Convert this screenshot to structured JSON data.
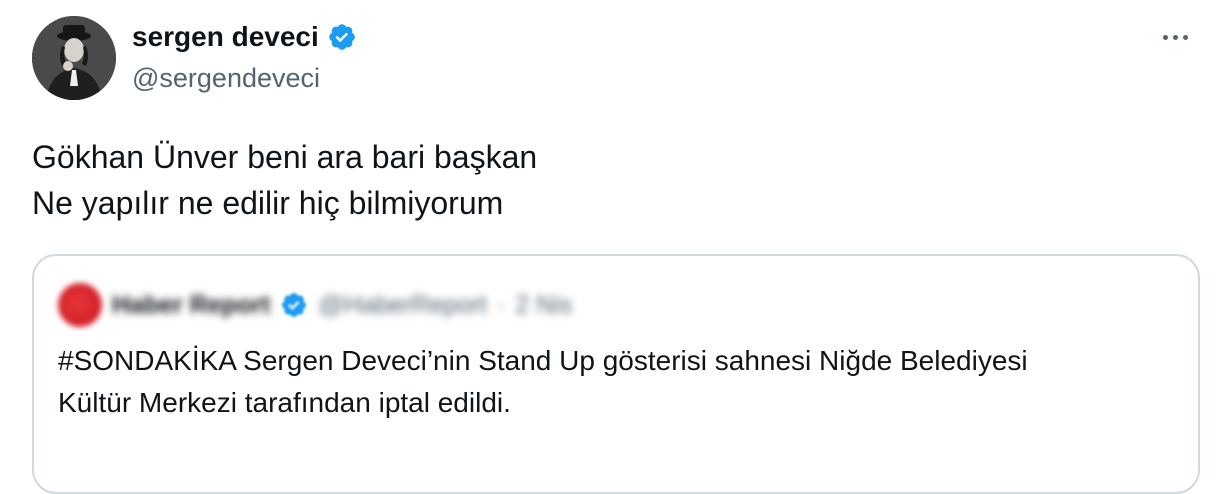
{
  "author": {
    "display_name": "sergen deveci",
    "handle": "@sergendeveci",
    "verified": true
  },
  "tweet": {
    "lines": [
      "Gökhan Ünver beni ara bari başkan",
      "Ne yapılır ne edilir hiç bilmiyorum"
    ]
  },
  "quoted_tweet": {
    "display_name": "Haber Report",
    "handle": "@HaberReport",
    "separator": "·",
    "date": "2 Nis",
    "verified": true,
    "lines": [
      "#SONDAKİKA Sergen Deveci’nin Stand Up gösterisi sahnesi Niğde Belediyesi",
      "Kültür Merkezi tarafından iptal edildi."
    ]
  },
  "icons": {
    "more": "more-horizontal-icon",
    "verified": "verified-badge-icon"
  },
  "colors": {
    "verified_blue": "#1d9bf0",
    "secondary_text": "#536471",
    "border": "#cfd9de",
    "quote_avatar_red": "#d4232a"
  }
}
